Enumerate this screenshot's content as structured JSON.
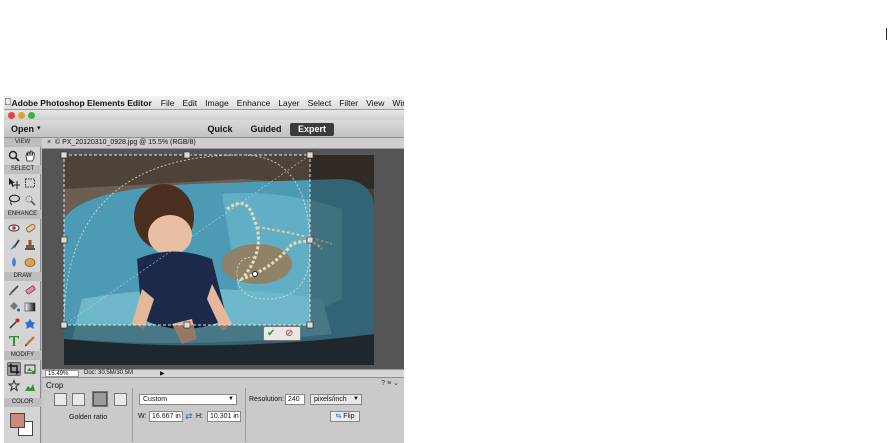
{
  "menubar": {
    "app_name": "Adobe Photoshop Elements Editor",
    "items": [
      "File",
      "Edit",
      "Image",
      "Enhance",
      "Layer",
      "Select",
      "Filter",
      "View",
      "Window"
    ]
  },
  "modebar": {
    "open_label": "Open",
    "modes": [
      "Quick",
      "Guided",
      "Expert"
    ],
    "active_mode": "Expert"
  },
  "toolbox": {
    "sections": [
      "VIEW",
      "SELECT",
      "ENHANCE",
      "DRAW",
      "MODIFY",
      "COLOR"
    ],
    "foreground_color": "#c98c7c",
    "background_color": "#ffffff",
    "selected_tool": "crop-tool"
  },
  "document": {
    "tab_title": "© PX_20120310_0928.jpg @ 15.5% (RGB/8)",
    "zoom": "15.49%",
    "doc_size": "Doc: 30.5M/30.5M"
  },
  "options": {
    "title": "Crop",
    "overlay_label": "Golden ratio",
    "preset": "Custom",
    "width_label": "W:",
    "width_value": "16.667 in",
    "height_label": "H:",
    "height_value": "10.301 in",
    "resolution_label": "Resolution:",
    "resolution_value": "240",
    "units": "pixels/inch",
    "flip_label": "Flip"
  }
}
